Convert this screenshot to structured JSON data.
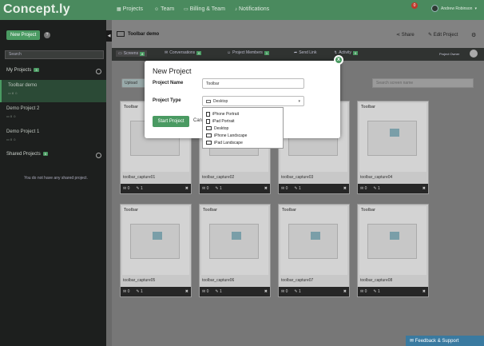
{
  "app": {
    "logo": "Concept.ly"
  },
  "topnav": [
    {
      "icon": "grid-icon",
      "label": "Projects"
    },
    {
      "icon": "users-icon",
      "label": "Team"
    },
    {
      "icon": "card-icon",
      "label": "Billing & Team"
    },
    {
      "icon": "bell-icon",
      "label": "Notifications"
    }
  ],
  "notification_count": "0",
  "user": {
    "name": "Andrew Robinson"
  },
  "sidebar": {
    "new_project": "New Project",
    "search_placeholder": "Search",
    "my_projects": {
      "label": "My Projects",
      "count": "3"
    },
    "projects": [
      {
        "name": "Toolbar demo",
        "meta": "8"
      },
      {
        "name": "Demo Project 2",
        "meta": "0"
      },
      {
        "name": "Demo Project 1",
        "meta": "0"
      }
    ],
    "shared_projects": {
      "label": "Shared Projects",
      "count": "0"
    },
    "shared_empty": "You do not have any shared project."
  },
  "project": {
    "title": "Toolbar demo",
    "share": "Share",
    "edit": "Edit Project",
    "owner": "Project Owner"
  },
  "tabs": [
    {
      "label": "Screens",
      "badge": "8"
    },
    {
      "label": "Conversations",
      "badge": "0"
    },
    {
      "label": "Project Members",
      "badge": "1"
    },
    {
      "label": "Send Link",
      "badge": ""
    },
    {
      "label": "Activity",
      "badge": "0"
    }
  ],
  "screens": {
    "upload": "Upload",
    "search_placeholder": "Search screen name",
    "cards": [
      {
        "name": "toolbar_capture01",
        "comments": "0",
        "edits": "1"
      },
      {
        "name": "toolbar_capture02",
        "comments": "0",
        "edits": "1"
      },
      {
        "name": "toolbar_capture03",
        "comments": "0",
        "edits": "1"
      },
      {
        "name": "toolbar_capture04",
        "comments": "0",
        "edits": "1"
      },
      {
        "name": "toolbar_capture05",
        "comments": "0",
        "edits": "1"
      },
      {
        "name": "toolbar_capture06",
        "comments": "0",
        "edits": "1"
      },
      {
        "name": "toolbar_capture07",
        "comments": "0",
        "edits": "1"
      },
      {
        "name": "toolbar_capture08",
        "comments": "0",
        "edits": "1"
      }
    ],
    "thumb_title": "Toolbar"
  },
  "modal": {
    "title": "New Project",
    "name_label": "Project Name",
    "name_value": "Toolbar",
    "type_label": "Project Type",
    "type_value": "Desktop",
    "start": "Start Project",
    "cancel": "Cancel",
    "close": "x",
    "options": [
      "iPhone Portrait",
      "iPad Portrait",
      "Desktop",
      "iPhone Landscape",
      "iPad Landscape"
    ]
  },
  "feedback": "Feedback & Support",
  "colors": {
    "brand": "#4a9a62",
    "topbar": "#4a8a5e",
    "sidebar": "#1d1f1e"
  }
}
